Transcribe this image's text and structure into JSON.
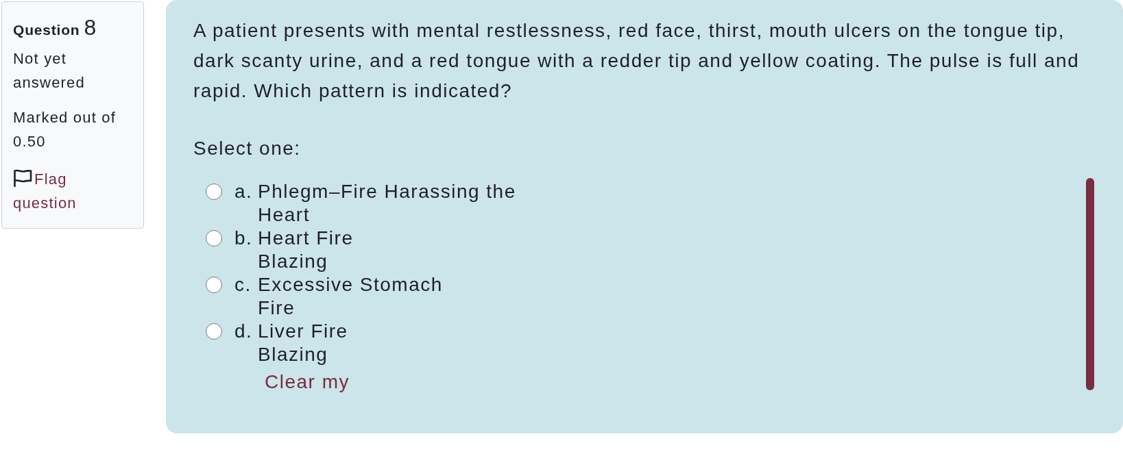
{
  "question_info": {
    "title": "Question",
    "number": "8",
    "status": "Not yet answered",
    "mark": "Marked out of 0.50",
    "flag": {
      "label": "Flag question",
      "flagged": false
    }
  },
  "question": {
    "text": "A patient presents with mental restlessness, red face, thirst, mouth ulcers on the tongue tip, dark scanty urine, and a red tongue with a redder tip and yellow coating. The pulse is full and rapid. Which pattern is indicated?",
    "prompt": "Select one:",
    "options": [
      {
        "letter": "a.",
        "label": "Phlegm–Fire Harassing the\nHeart",
        "selected": false
      },
      {
        "letter": "b.",
        "label": "Heart Fire\nBlazing",
        "selected": false
      },
      {
        "letter": "c.",
        "label": "Excessive Stomach\nFire",
        "selected": false
      },
      {
        "letter": "d.",
        "label": "Liver Fire\nBlazing",
        "selected": false
      }
    ],
    "clear_link": "Clear my"
  }
}
